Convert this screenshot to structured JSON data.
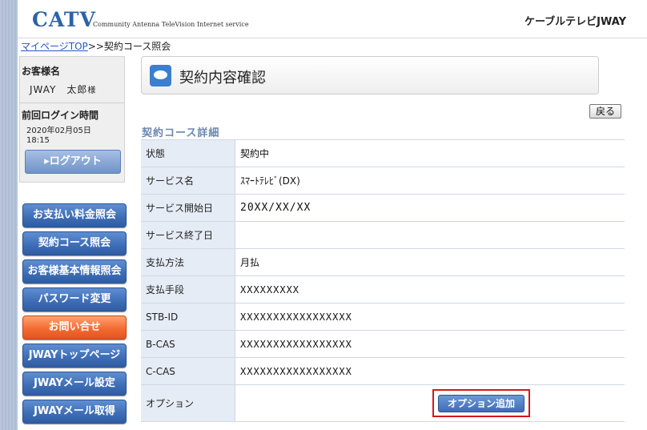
{
  "header": {
    "logo": "CATV",
    "logo_sub": "Community Antenna TeleVision Internet service",
    "brand": "ケーブルテレビJWAY"
  },
  "breadcrumb": {
    "link": "マイページTOP",
    "separator": ">>",
    "current": "契約コース照会"
  },
  "user": {
    "name_label": "お客様名",
    "name": "JWAY　太郎",
    "honorific": "様",
    "last_login_label": "前回ログイン時間",
    "last_login_date": "2020年02月05日",
    "last_login_time": "18:15",
    "logout_label": "▸ログアウト"
  },
  "nav": {
    "items": [
      {
        "label": "お支払い料金照会"
      },
      {
        "label": "契約コース照会"
      },
      {
        "label": "お客様基本情報照会"
      },
      {
        "label": "パスワード変更"
      },
      {
        "label": "お問い合せ"
      },
      {
        "label": "JWAYトップページ"
      },
      {
        "label": "JWAYメール設定"
      },
      {
        "label": "JWAYメール取得"
      }
    ]
  },
  "main": {
    "title": "契約内容確認",
    "back_label": "戻る",
    "section_title": "契約コース詳細",
    "rows": [
      {
        "label": "状態",
        "value": "契約中"
      },
      {
        "label": "サービス名",
        "value": "ｽﾏｰﾄﾃﾚﾋﾞ(DX)"
      },
      {
        "label": "サービス開始日",
        "value": "20XX/XX/XX"
      },
      {
        "label": "サービス終了日",
        "value": ""
      },
      {
        "label": "支払方法",
        "value": "月払"
      },
      {
        "label": "支払手段",
        "value": "XXXXXXXXX"
      },
      {
        "label": "STB-ID",
        "value": "XXXXXXXXXXXXXXXXX"
      },
      {
        "label": "B-CAS",
        "value": "XXXXXXXXXXXXXXXXX"
      },
      {
        "label": "C-CAS",
        "value": "XXXXXXXXXXXXXXXXX"
      },
      {
        "label": "オプション",
        "value": ""
      }
    ],
    "option_button": "オプション追加"
  },
  "colors": {
    "accent": "#2d63a8",
    "nav_button": "#3f6fb7",
    "contact_button": "#f36b33",
    "highlight_border": "#d21919",
    "label_bg": "#e6ecf5"
  }
}
